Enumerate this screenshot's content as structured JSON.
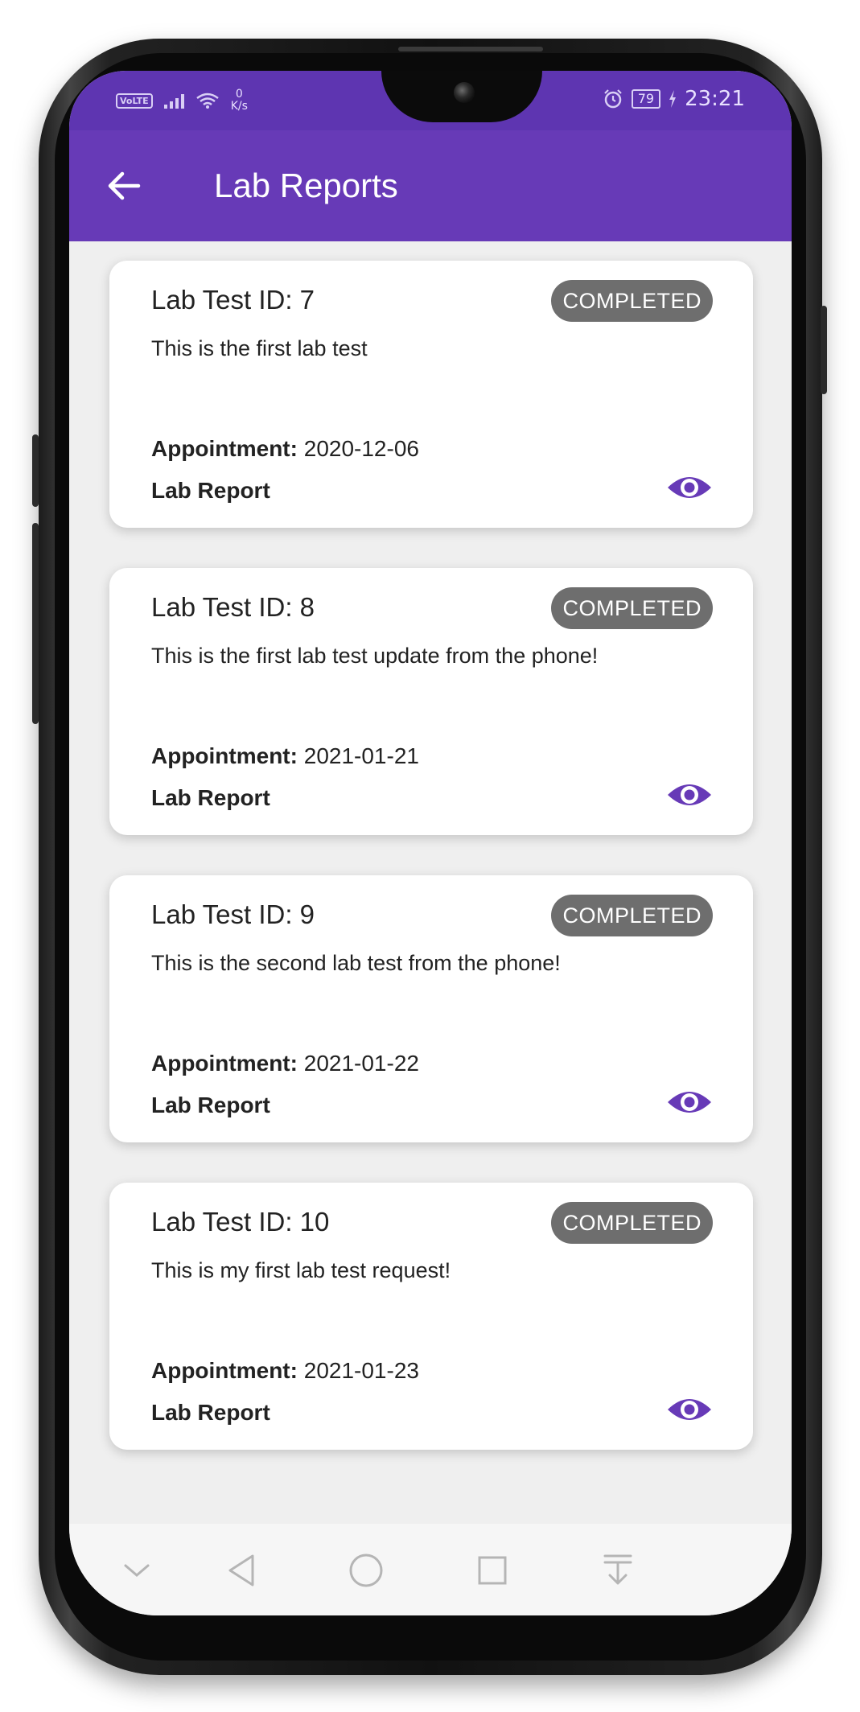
{
  "status_bar": {
    "volte": "VoLTE",
    "netspeed_value": "0",
    "netspeed_unit": "K/s",
    "battery": "79",
    "time": "23:21"
  },
  "app_bar": {
    "title": "Lab Reports"
  },
  "lab_tests": [
    {
      "title": "Lab Test ID: 7",
      "status": "COMPLETED",
      "description": "This is the first lab test",
      "appointment_label": "Appointment:",
      "appointment_date": "2020-12-06",
      "report_label": "Lab Report"
    },
    {
      "title": "Lab Test ID: 8",
      "status": "COMPLETED",
      "description": "This is the first lab test update from the phone!",
      "appointment_label": "Appointment:",
      "appointment_date": "2021-01-21",
      "report_label": "Lab Report"
    },
    {
      "title": "Lab Test ID: 9",
      "status": "COMPLETED",
      "description": "This is the second lab test from the phone!",
      "appointment_label": "Appointment:",
      "appointment_date": "2021-01-22",
      "report_label": "Lab Report"
    },
    {
      "title": "Lab Test ID: 10",
      "status": "COMPLETED",
      "description": "This is my first lab test request!",
      "appointment_label": "Appointment:",
      "appointment_date": "2021-01-23",
      "report_label": "Lab Report"
    }
  ],
  "icons": {
    "back": "arrow-left-icon",
    "view": "eye-icon",
    "nav": [
      "chevron-down-icon",
      "back-triangle-icon",
      "home-circle-icon",
      "recents-square-icon",
      "notification-pull-icon"
    ]
  },
  "colors": {
    "primary": "#673ab7",
    "status_bar": "#5e35b1",
    "badge": "#6e6e6e",
    "eye_icon": "#673ab7",
    "background": "#efefef"
  }
}
